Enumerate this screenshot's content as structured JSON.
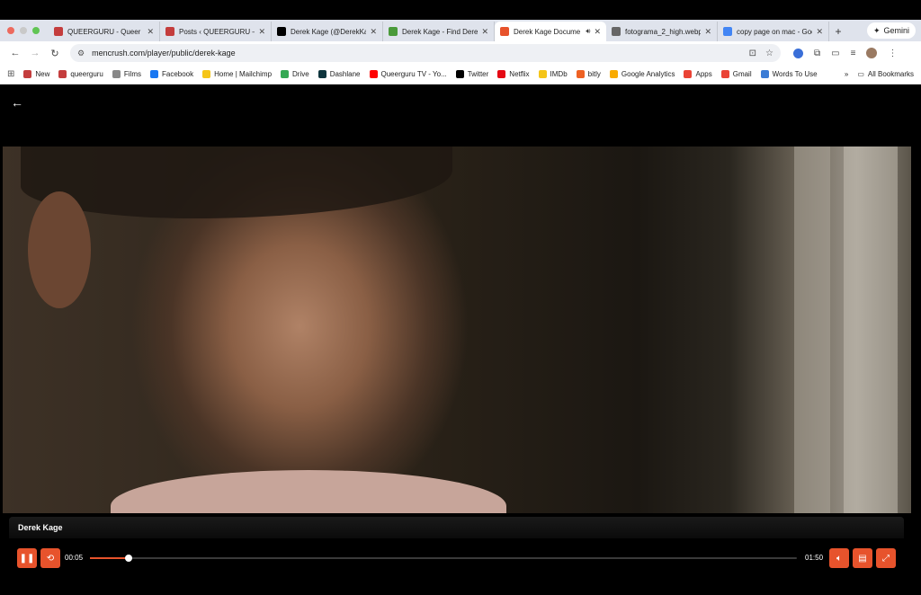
{
  "browser": {
    "tabs": [
      {
        "label": "QUEERGURU - Queer Me",
        "icon": "queerguru-icon",
        "icon_color": "#c43d3d",
        "active": false
      },
      {
        "label": "Posts ‹ QUEERGURU —",
        "icon": "queerguru-icon",
        "icon_color": "#c43d3d",
        "active": false
      },
      {
        "label": "Derek Kage (@DerekKag",
        "icon": "x-icon",
        "icon_color": "#000000",
        "active": false
      },
      {
        "label": "Derek Kage - Find Dere",
        "icon": "findagrave-icon",
        "icon_color": "#4a9a3a",
        "active": false
      },
      {
        "label": "Derek Kage Docume",
        "icon": "mencrush-icon",
        "icon_color": "#e7532c",
        "active": true
      },
      {
        "label": "fotograma_2_high.webp",
        "icon": "globe-icon",
        "icon_color": "#666666",
        "active": false
      },
      {
        "label": "copy page on mac - Goo",
        "icon": "google-icon",
        "icon_color": "#4285f4",
        "active": false
      }
    ],
    "gemini_label": "Gemini",
    "url": "mencrush.com/player/public/derek-kage",
    "bookmarks": [
      {
        "label": "New",
        "color": "#c43d3d"
      },
      {
        "label": "queerguru",
        "color": "#c43d3d"
      },
      {
        "label": "Films",
        "color": "#888888"
      },
      {
        "label": "Facebook",
        "color": "#1877f2"
      },
      {
        "label": "Home | Mailchimp",
        "color": "#f5c518"
      },
      {
        "label": "Drive",
        "color": "#34a853"
      },
      {
        "label": "Dashlane",
        "color": "#0e353d"
      },
      {
        "label": "Queerguru TV - Yo...",
        "color": "#ff0000"
      },
      {
        "label": "Twitter",
        "color": "#000000"
      },
      {
        "label": "Netflix",
        "color": "#e50914"
      },
      {
        "label": "IMDb",
        "color": "#f5c518"
      },
      {
        "label": "bitly",
        "color": "#ee6123"
      },
      {
        "label": "Google Analytics",
        "color": "#f9ab00"
      },
      {
        "label": "Apps",
        "color": "#ea4335"
      },
      {
        "label": "Gmail",
        "color": "#ea4335"
      },
      {
        "label": "Words To Use",
        "color": "#3a7bd5"
      }
    ],
    "all_bookmarks_label": "All Bookmarks"
  },
  "player": {
    "title": "Derek Kage",
    "current_time": "00:05",
    "duration": "01:50",
    "progress_fraction": 0.055,
    "accent_color": "#e7532c"
  }
}
